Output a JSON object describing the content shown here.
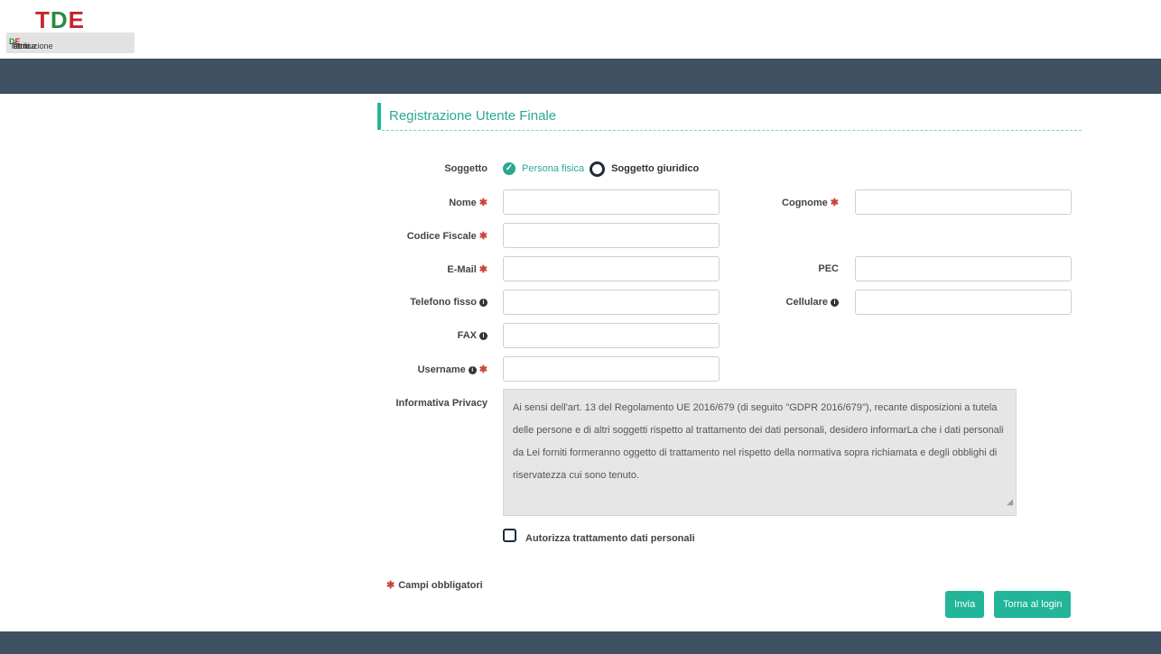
{
  "logo": {
    "brand": "TDE",
    "b1": "T",
    "b2": "D",
    "b3": "E",
    "sub_1": "Terni ",
    "sub_2": "D",
    "sub_3": "istribuzione ",
    "sub_4": "E",
    "sub_5": "lettrica"
  },
  "page": {
    "title": "Registrazione Utente Finale"
  },
  "form": {
    "soggetto_label": "Soggetto",
    "radio_persona": "Persona fisica",
    "radio_giuridico": "Soggetto giuridico",
    "nome_label": "Nome",
    "cognome_label": "Cognome",
    "codice_label": "Codice Fiscale",
    "email_label": "E-Mail",
    "pec_label": "PEC",
    "telefono_label": "Telefono fisso",
    "cellulare_label": "Cellulare",
    "fax_label": "FAX",
    "username_label": "Username",
    "privacy_label": "Informativa Privacy",
    "required_mark": "✱",
    "info_mark": "i",
    "selected_mark": "✓"
  },
  "values": {
    "nome": "",
    "cognome": "",
    "codice": "",
    "email": "",
    "pec": "",
    "telefono": "",
    "cellulare": "",
    "fax": "",
    "username": ""
  },
  "privacy_text": "Ai sensi dell'art. 13 del Regolamento UE 2016/679 (di seguito \"GDPR 2016/679\"), recante disposizioni a tutela delle persone e di altri soggetti rispetto al trattamento dei dati personali, desidero informarLa che i dati personali da Lei forniti formeranno oggetto di trattamento nel rispetto della normativa sopra richiamata e degli obblighi di riservatezza cui sono tenuto.",
  "privacy_consent": "Autorizza trattamento dati personali",
  "footer": {
    "required_note": "Campi obbligatori"
  },
  "buttons": {
    "submit": "Invia",
    "back": "Torna al login"
  },
  "colors": {
    "accent": "#22b59a",
    "nav": "#3e5062",
    "required": "#c9443a"
  }
}
